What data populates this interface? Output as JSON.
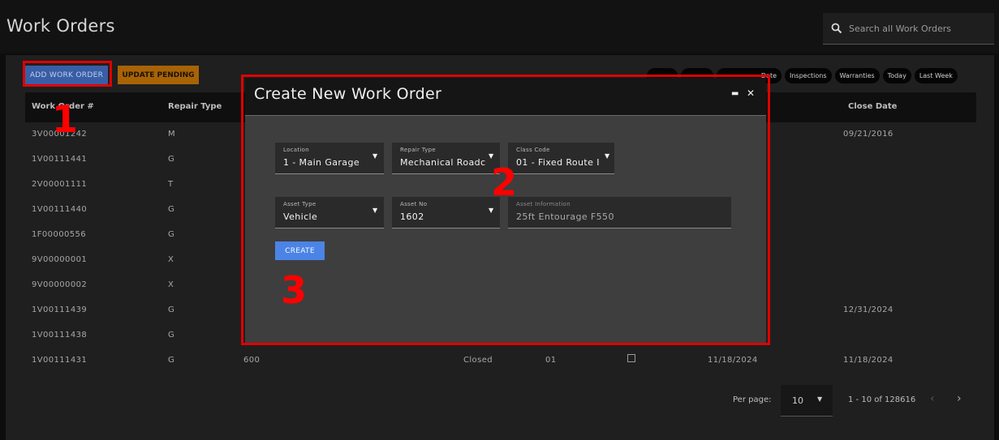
{
  "header": {
    "title": "Work Orders",
    "search_placeholder": "Search all Work Orders"
  },
  "toolbar": {
    "add_label": "ADD WORK ORDER",
    "pending_label": "UPDATE PENDING",
    "chips": [
      "",
      "",
      "Date",
      "Inspections",
      "Warranties",
      "Today",
      "Last Week"
    ]
  },
  "table": {
    "columns": [
      "Work Order #",
      "Repair Type",
      "Close Date"
    ],
    "rows": [
      {
        "wo": "3V00001242",
        "type": "M",
        "location": "",
        "status": "",
        "class": "",
        "open": "",
        "close": "09/21/2016"
      },
      {
        "wo": "1V00111441",
        "type": "G",
        "location": "",
        "status": "",
        "class": "",
        "open": "",
        "close": ""
      },
      {
        "wo": "2V00001111",
        "type": "T",
        "location": "",
        "status": "",
        "class": "",
        "open": "",
        "close": ""
      },
      {
        "wo": "1V00111440",
        "type": "G",
        "location": "",
        "status": "",
        "class": "",
        "open": "",
        "close": ""
      },
      {
        "wo": "1F00000556",
        "type": "G",
        "location": "",
        "status": "",
        "class": "",
        "open": "",
        "close": ""
      },
      {
        "wo": "9V00000001",
        "type": "X",
        "location": "",
        "status": "",
        "class": "",
        "open": "",
        "close": ""
      },
      {
        "wo": "9V00000002",
        "type": "X",
        "location": "",
        "status": "",
        "class": "",
        "open": "",
        "close": ""
      },
      {
        "wo": "1V00111439",
        "type": "G",
        "location": "",
        "status": "",
        "class": "",
        "open": "",
        "close": "12/31/2024"
      },
      {
        "wo": "1V00111438",
        "type": "G",
        "location": "",
        "status": "",
        "class": "",
        "open": "",
        "close": ""
      },
      {
        "wo": "1V00111431",
        "type": "G",
        "location": "600",
        "status": "Closed",
        "class": "01",
        "open": "11/18/2024",
        "close": "11/18/2024"
      }
    ]
  },
  "pagination": {
    "per_page_label": "Per page:",
    "per_page_value": "10",
    "range": "1 - 10 of 128616"
  },
  "modal": {
    "title": "Create New Work Order",
    "location": {
      "label": "Location",
      "value": "1 - Main Garage"
    },
    "repair_type": {
      "label": "Repair Type",
      "value": "Mechanical Roadc"
    },
    "class_code": {
      "label": "Class Code",
      "value": "01 - Fixed Route I"
    },
    "asset_type": {
      "label": "Asset Type",
      "value": "Vehicle"
    },
    "asset_no": {
      "label": "Asset No",
      "value": "1602"
    },
    "asset_info": {
      "label": "Asset Information",
      "value": "25ft Entourage F550"
    },
    "create_label": "CREATE"
  },
  "annotations": {
    "step1": "1",
    "step2": "2",
    "step3": "3"
  },
  "colors": {
    "accent_blue": "#4b84e6",
    "pending_orange": "#a76306",
    "annotation_red": "#e00000"
  }
}
